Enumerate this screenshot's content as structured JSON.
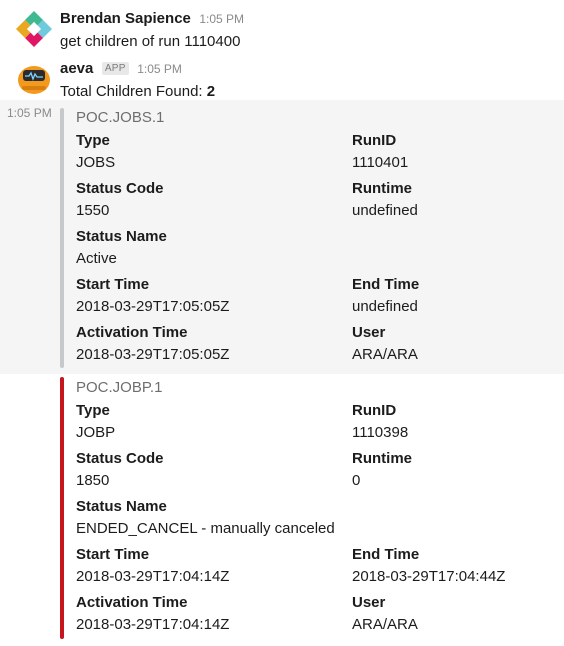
{
  "messages": {
    "user": {
      "sender": "Brendan Sapience",
      "time": "1:05 PM",
      "text": "get children of run 1110400"
    },
    "bot": {
      "sender": "aeva",
      "badge": "APP",
      "time": "1:05 PM",
      "summary_label": "Total Children Found: ",
      "summary_count": "2"
    }
  },
  "attachments": [
    {
      "gutter_time": "1:05 PM",
      "title": "POC.JOBS.1",
      "bar_color": "#c6c9cc",
      "type_label": "Type",
      "type": "JOBS",
      "runid_label": "RunID",
      "runid": "1110401",
      "status_code_label": "Status Code",
      "status_code": "1550",
      "runtime_label": "Runtime",
      "runtime": "undefined",
      "status_name_label": "Status Name",
      "status_name": "Active",
      "start_time_label": "Start Time",
      "start_time": "2018-03-29T17:05:05Z",
      "end_time_label": "End Time",
      "end_time": "undefined",
      "activation_time_label": "Activation Time",
      "activation_time": "2018-03-29T17:05:05Z",
      "user_label": "User",
      "user": "ARA/ARA"
    },
    {
      "title": "POC.JOBP.1",
      "bar_color": "#c4161c",
      "type_label": "Type",
      "type": "JOBP",
      "runid_label": "RunID",
      "runid": "1110398",
      "status_code_label": "Status Code",
      "status_code": "1850",
      "runtime_label": "Runtime",
      "runtime": "0",
      "status_name_label": "Status Name",
      "status_name": "ENDED_CANCEL - manually canceled",
      "start_time_label": "Start Time",
      "start_time": "2018-03-29T17:04:14Z",
      "end_time_label": "End Time",
      "end_time": "2018-03-29T17:04:44Z",
      "activation_time_label": "Activation Time",
      "activation_time": "2018-03-29T17:04:14Z",
      "user_label": "User",
      "user": "ARA/ARA"
    }
  ]
}
